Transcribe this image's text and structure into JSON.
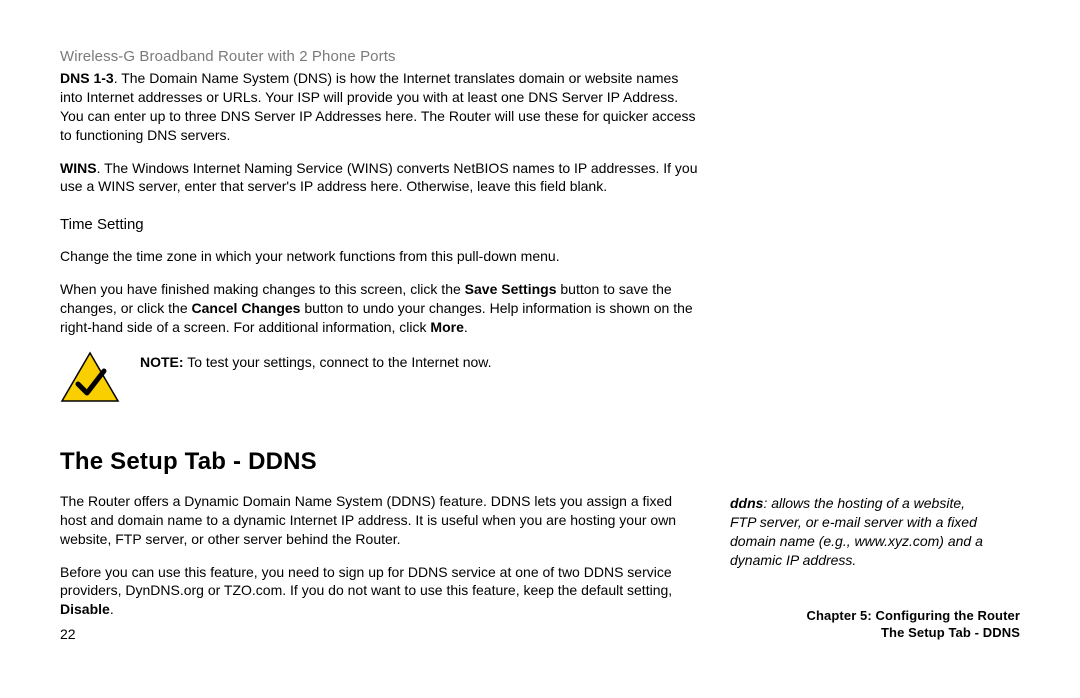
{
  "header": {
    "product": "Wireless-G Broadband Router with 2 Phone Ports"
  },
  "dns": {
    "label": "DNS 1-3",
    "text": ". The Domain Name System (DNS) is how the Internet translates domain or website names into Internet addresses or URLs. Your ISP will provide you with at least one DNS Server IP Address. You can enter up to three DNS Server IP Addresses here. The Router will use these for quicker access to functioning DNS servers."
  },
  "wins": {
    "label": "WINS",
    "text": ". The Windows Internet Naming Service (WINS) converts NetBIOS names to IP addresses. If you use a WINS server, enter that server's IP address here. Otherwise, leave this field blank."
  },
  "timesetting": {
    "heading": "Time Setting",
    "p1": "Change the time zone in which your network functions from this pull-down menu.",
    "p2a": "When you have finished making changes to this screen, click the ",
    "save": "Save Settings",
    "p2b": " button to save the changes, or click the ",
    "cancel": "Cancel Changes",
    "p2c": " button to undo your changes. Help information is shown on the right-hand side of a screen. For additional information, click ",
    "more": "More",
    "p2d": "."
  },
  "note": {
    "label": "NOTE:",
    "text": "  To test your settings, connect to the Internet now."
  },
  "ddns": {
    "heading": "The Setup Tab - DDNS",
    "p1": "The Router offers a Dynamic Domain Name System (DDNS) feature. DDNS lets you assign a fixed host and domain name to a dynamic Internet IP address. It is useful when you are hosting your own website, FTP server, or other server behind the Router.",
    "p2a": "Before you can use this feature, you need to sign up for DDNS service at one of two DDNS service providers, DynDNS.org or TZO.com. If you do not want to use this feature, keep the default setting, ",
    "disable": "Disable",
    "p2b": "."
  },
  "sidebar": {
    "term": "ddns",
    "def": ": allows the hosting of a website, FTP server, or e-mail server with a fixed domain name (e.g., www.xyz.com) and a dynamic IP address."
  },
  "footer": {
    "page": "22",
    "chapter": "Chapter 5: Configuring the Router",
    "section": "The Setup Tab - DDNS"
  }
}
